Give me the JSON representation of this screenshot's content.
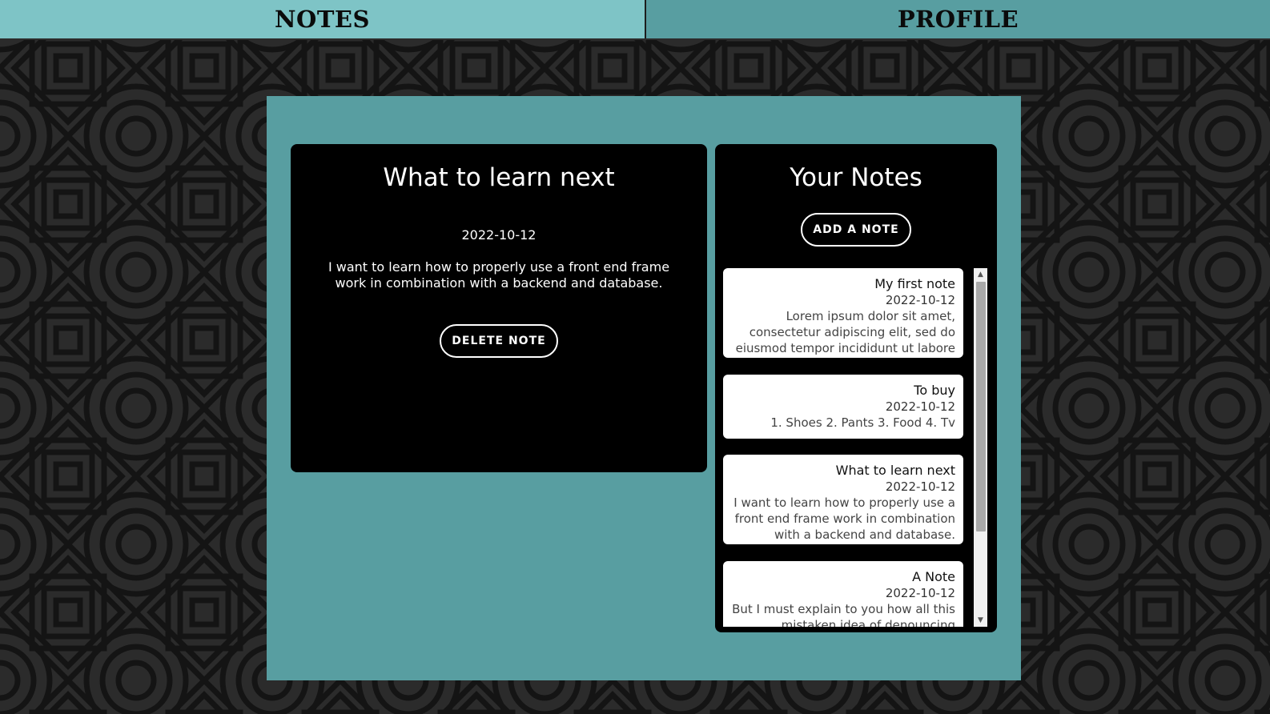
{
  "nav": {
    "notes_label": "NOTES",
    "profile_label": "PROFILE"
  },
  "detail": {
    "title": "What to learn next",
    "date": "2022-10-12",
    "body": "I want to learn how to properly use a front end frame work in combination with a backend and database.",
    "delete_label": "DELETE NOTE"
  },
  "list": {
    "title": "Your Notes",
    "add_label": "ADD A NOTE",
    "notes": [
      {
        "title": "My first note",
        "date": "2022-10-12",
        "body": "Lorem ipsum dolor sit amet, consectetur adipiscing elit, sed do eiusmod tempor incididunt ut labore"
      },
      {
        "title": "To buy",
        "date": "2022-10-12",
        "body": "1. Shoes 2. Pants 3. Food 4. Tv"
      },
      {
        "title": "What to learn next",
        "date": "2022-10-12",
        "body": "I want to learn how to properly use a front end frame work in combination with a backend and database."
      },
      {
        "title": "A Note",
        "date": "2022-10-12",
        "body": "But I must explain to you how all this mistaken idea of denouncing"
      }
    ]
  },
  "colors": {
    "nav_notes_bg": "#7ec4c6",
    "nav_profile_bg": "#589ea1",
    "panel_bg": "#589ea1",
    "card_bg": "#000000",
    "note_bg": "#ffffff",
    "pattern_bg": "#2a2a2a",
    "pattern_line": "#161616"
  },
  "icons": {
    "scroll_up": "triangle-up-icon",
    "scroll_down": "triangle-down-icon"
  }
}
